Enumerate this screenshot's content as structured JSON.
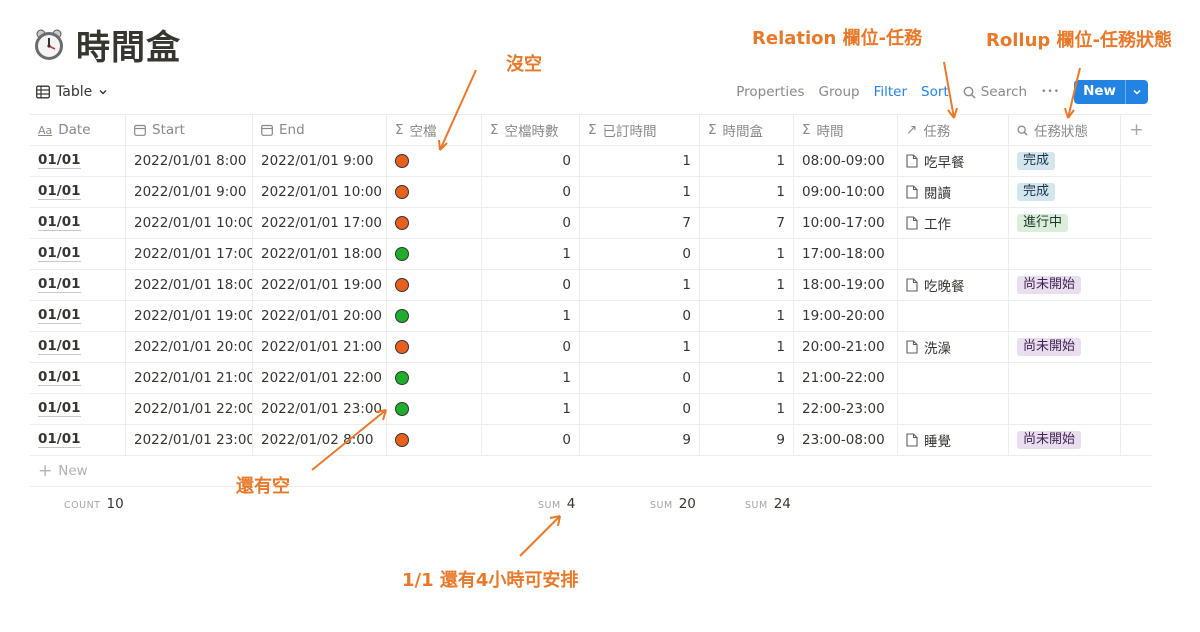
{
  "page": {
    "title": "時間盒",
    "icon": "alarm-clock-icon"
  },
  "toolbar": {
    "view_label": "Table",
    "properties": "Properties",
    "group": "Group",
    "filter": "Filter",
    "sort": "Sort",
    "search": "Search",
    "more": "•••",
    "new_label": "New"
  },
  "columns": {
    "date": "Date",
    "start": "Start",
    "end": "End",
    "avail": "空檔",
    "avail_hours": "空檔時數",
    "booked_hours": "已訂時間",
    "box": "時間盒",
    "time": "時間",
    "task": "任務",
    "status": "任務狀態",
    "add": "+"
  },
  "rows": [
    {
      "date": "01/01",
      "start": "2022/01/01 8:00",
      "end": "2022/01/01 9:00",
      "avail": "busy",
      "avail_hours": "0",
      "booked_hours": "1",
      "box": "1",
      "time": "08:00-09:00",
      "task": "吃早餐",
      "status": "完成"
    },
    {
      "date": "01/01",
      "start": "2022/01/01 9:00",
      "end": "2022/01/01 10:00",
      "avail": "busy",
      "avail_hours": "0",
      "booked_hours": "1",
      "box": "1",
      "time": "09:00-10:00",
      "task": "閱讀",
      "status": "完成"
    },
    {
      "date": "01/01",
      "start": "2022/01/01 10:00",
      "end": "2022/01/01 17:00",
      "avail": "busy",
      "avail_hours": "0",
      "booked_hours": "7",
      "box": "7",
      "time": "10:00-17:00",
      "task": "工作",
      "status": "進行中"
    },
    {
      "date": "01/01",
      "start": "2022/01/01 17:00",
      "end": "2022/01/01 18:00",
      "avail": "free",
      "avail_hours": "1",
      "booked_hours": "0",
      "box": "1",
      "time": "17:00-18:00",
      "task": "",
      "status": ""
    },
    {
      "date": "01/01",
      "start": "2022/01/01 18:00",
      "end": "2022/01/01 19:00",
      "avail": "busy",
      "avail_hours": "0",
      "booked_hours": "1",
      "box": "1",
      "time": "18:00-19:00",
      "task": "吃晚餐",
      "status": "尚未開始"
    },
    {
      "date": "01/01",
      "start": "2022/01/01 19:00",
      "end": "2022/01/01 20:00",
      "avail": "free",
      "avail_hours": "1",
      "booked_hours": "0",
      "box": "1",
      "time": "19:00-20:00",
      "task": "",
      "status": ""
    },
    {
      "date": "01/01",
      "start": "2022/01/01 20:00",
      "end": "2022/01/01 21:00",
      "avail": "busy",
      "avail_hours": "0",
      "booked_hours": "1",
      "box": "1",
      "time": "20:00-21:00",
      "task": "洗澡",
      "status": "尚未開始"
    },
    {
      "date": "01/01",
      "start": "2022/01/01 21:00",
      "end": "2022/01/01 22:00",
      "avail": "free",
      "avail_hours": "1",
      "booked_hours": "0",
      "box": "1",
      "time": "21:00-22:00",
      "task": "",
      "status": ""
    },
    {
      "date": "01/01",
      "start": "2022/01/01 22:00",
      "end": "2022/01/01 23:00",
      "avail": "free",
      "avail_hours": "1",
      "booked_hours": "0",
      "box": "1",
      "time": "22:00-23:00",
      "task": "",
      "status": ""
    },
    {
      "date": "01/01",
      "start": "2022/01/01 23:00",
      "end": "2022/01/02 8:00",
      "avail": "busy",
      "avail_hours": "0",
      "booked_hours": "9",
      "box": "9",
      "time": "23:00-08:00",
      "task": "睡覺",
      "status": "尚未開始"
    }
  ],
  "new_row_label": "New",
  "footer": {
    "count_key": "COUNT",
    "count_val": "10",
    "sum_key": "SUM",
    "sum_avail": "4",
    "sum_booked": "20",
    "sum_box": "24"
  },
  "annotations": {
    "relation": "Relation 欄位-任務",
    "rollup": "Rollup 欄位-任務狀態",
    "no_slot": "沒空",
    "has_slot": "還有空",
    "summary": "1/1 還有4小時可安排"
  },
  "colors": {
    "busy": "#e8601f",
    "free": "#1fae2b",
    "accent": "#2383e2",
    "annotation": "#e8792a",
    "status": {
      "完成": {
        "bg": "#d3e5ef",
        "fg": "#183347"
      },
      "進行中": {
        "bg": "#dbeddb",
        "fg": "#1c3829"
      },
      "尚未開始": {
        "bg": "#e8deee",
        "fg": "#412454"
      }
    }
  }
}
